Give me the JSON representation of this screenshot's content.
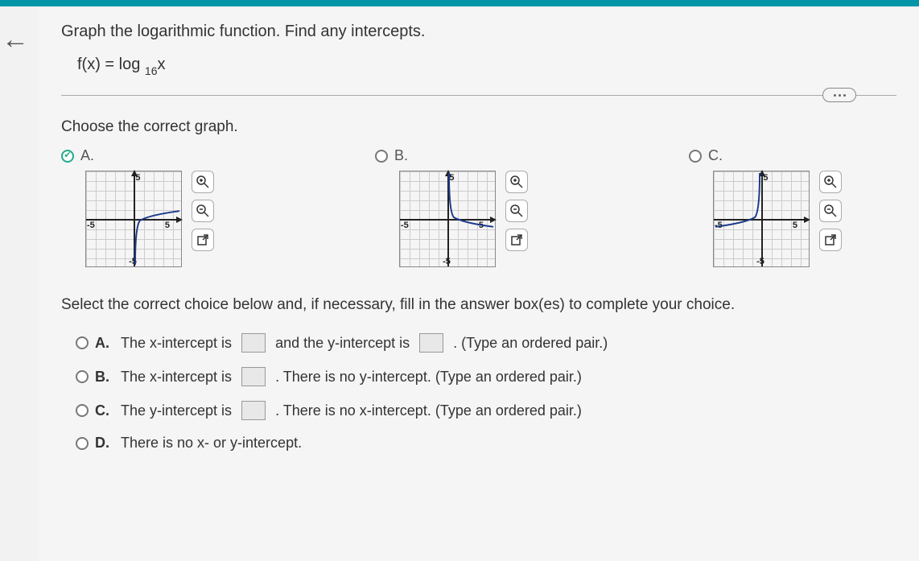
{
  "question": "Graph the logarithmic function. Find any intercepts.",
  "formula_head": "f(x) = log",
  "formula_sub": "16",
  "formula_tail": "x",
  "subhead": "Choose the correct graph.",
  "graphs": {
    "a": {
      "label": "A.",
      "selected": true
    },
    "b": {
      "label": "B.",
      "selected": false
    },
    "c": {
      "label": "C.",
      "selected": false
    }
  },
  "axis": {
    "top": "5",
    "bottom": "-5",
    "left": "-5",
    "right": "5"
  },
  "instruct": "Select the correct choice below and, if necessary, fill in the answer box(es) to complete your choice.",
  "answers": {
    "a": {
      "letter": "A.",
      "p1": "The x-intercept is",
      "p2": "and the y-intercept is",
      "p3": ". (Type an ordered pair.)"
    },
    "b": {
      "letter": "B.",
      "p1": "The x-intercept is",
      "p2": ". There is no y-intercept.  (Type an ordered pair.)"
    },
    "c": {
      "letter": "C.",
      "p1": "The y-intercept is",
      "p2": ". There is no x-intercept.  (Type an ordered pair.)"
    },
    "d": {
      "letter": "D.",
      "p1": "There is no x- or y-intercept."
    }
  }
}
